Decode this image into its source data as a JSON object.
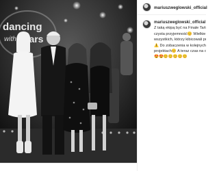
{
  "post": {
    "username": "mariuszweglowski_official",
    "header_avatar_icon": "profile-avatar-icon"
  },
  "caption": {
    "username": "mariuszweglowski_official",
    "lines": [
      "Z taką ekipą być na Finale Tańca z Gwiazdami to",
      "czysta przyjemność😊 Wielkie gratulacje dla",
      "wszystkich, którzy kibicowali programowi",
      "⚠️ Do zobaczenia w kolejnych",
      "projektach😊 A teraz czas na odpoczynek!",
      "😍😍😊😊😊😊😊"
    ]
  },
  "photo": {
    "backdrop_text_1": "dancing",
    "backdrop_text_2": "with",
    "backdrop_text_3": "stars",
    "description_icon": "group-photo-image"
  },
  "colors": {
    "text": "#262626",
    "border": "#efefef",
    "photo_bg": "#1c1c1c"
  }
}
